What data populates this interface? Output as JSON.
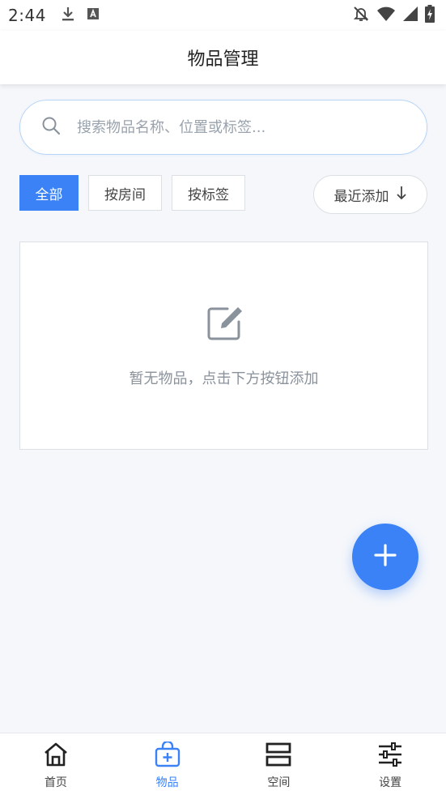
{
  "status_bar": {
    "time": "2:44",
    "icons": [
      "download-icon",
      "keyboard-a-icon",
      "notifications-off-icon",
      "wifi-icon",
      "signal-icon",
      "battery-charging-icon"
    ]
  },
  "header": {
    "title": "物品管理"
  },
  "search": {
    "placeholder": "搜索物品名称、位置或标签...",
    "value": ""
  },
  "filters": {
    "tabs": [
      {
        "label": "全部",
        "active": true
      },
      {
        "label": "按房间",
        "active": false
      },
      {
        "label": "按标签",
        "active": false
      }
    ],
    "sort_label": "最近添加"
  },
  "empty_state": {
    "message": "暂无物品，点击下方按钮添加",
    "icon": "edit-icon"
  },
  "fab": {
    "icon": "plus-icon"
  },
  "bottom_nav": {
    "items": [
      {
        "label": "首页",
        "icon": "home-icon",
        "active": false
      },
      {
        "label": "物品",
        "icon": "bag-plus-icon",
        "active": true
      },
      {
        "label": "空间",
        "icon": "storage-icon",
        "active": false
      },
      {
        "label": "设置",
        "icon": "sliders-icon",
        "active": false
      }
    ]
  },
  "colors": {
    "accent": "#3b82f6",
    "background": "#f5f7fb",
    "muted_text": "#8a929c"
  }
}
